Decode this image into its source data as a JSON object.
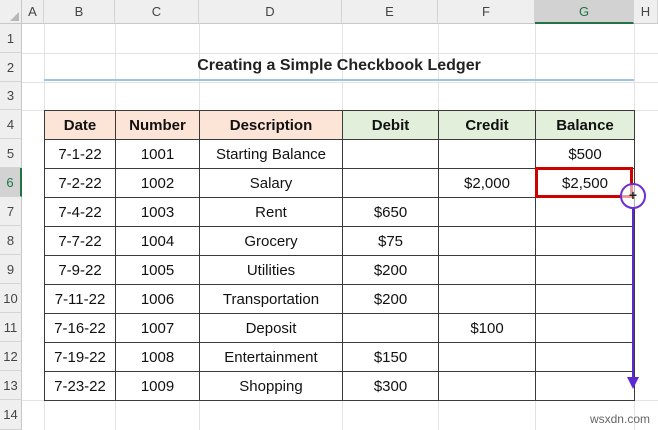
{
  "columns": [
    "A",
    "B",
    "C",
    "D",
    "E",
    "F",
    "G",
    "H"
  ],
  "rows": [
    "1",
    "2",
    "3",
    "4",
    "5",
    "6",
    "7",
    "8",
    "9",
    "10",
    "11",
    "12",
    "13",
    "14"
  ],
  "selected_column": "G",
  "selected_row": "6",
  "title": "Creating a Simple Checkbook Ledger",
  "table": {
    "headers": [
      "Date",
      "Number",
      "Description",
      "Debit",
      "Credit",
      "Balance"
    ],
    "rows": [
      [
        "7-1-22",
        "1001",
        "Starting Balance",
        "",
        "",
        "$500"
      ],
      [
        "7-2-22",
        "1002",
        "Salary",
        "",
        "$2,000",
        "$2,500"
      ],
      [
        "7-4-22",
        "1003",
        "Rent",
        "$650",
        "",
        ""
      ],
      [
        "7-7-22",
        "1004",
        "Grocery",
        "$75",
        "",
        ""
      ],
      [
        "7-9-22",
        "1005",
        "Utilities",
        "$200",
        "",
        ""
      ],
      [
        "7-11-22",
        "1006",
        "Transportation",
        "$200",
        "",
        ""
      ],
      [
        "7-16-22",
        "1007",
        "Deposit",
        "",
        "$100",
        ""
      ],
      [
        "7-19-22",
        "1008",
        "Entertainment",
        "$150",
        "",
        ""
      ],
      [
        "7-23-22",
        "1009",
        "Shopping",
        "$300",
        "",
        ""
      ]
    ]
  },
  "fill_handle_icon": "plus-cross-cursor-icon",
  "watermark": "wsxdn.com",
  "colors": {
    "header_orange": "#fce4d6",
    "header_green": "#e2efda",
    "selection_red": "#d00000",
    "arrow_purple": "#5b2bd0",
    "title_underline": "#9dc3e6"
  }
}
